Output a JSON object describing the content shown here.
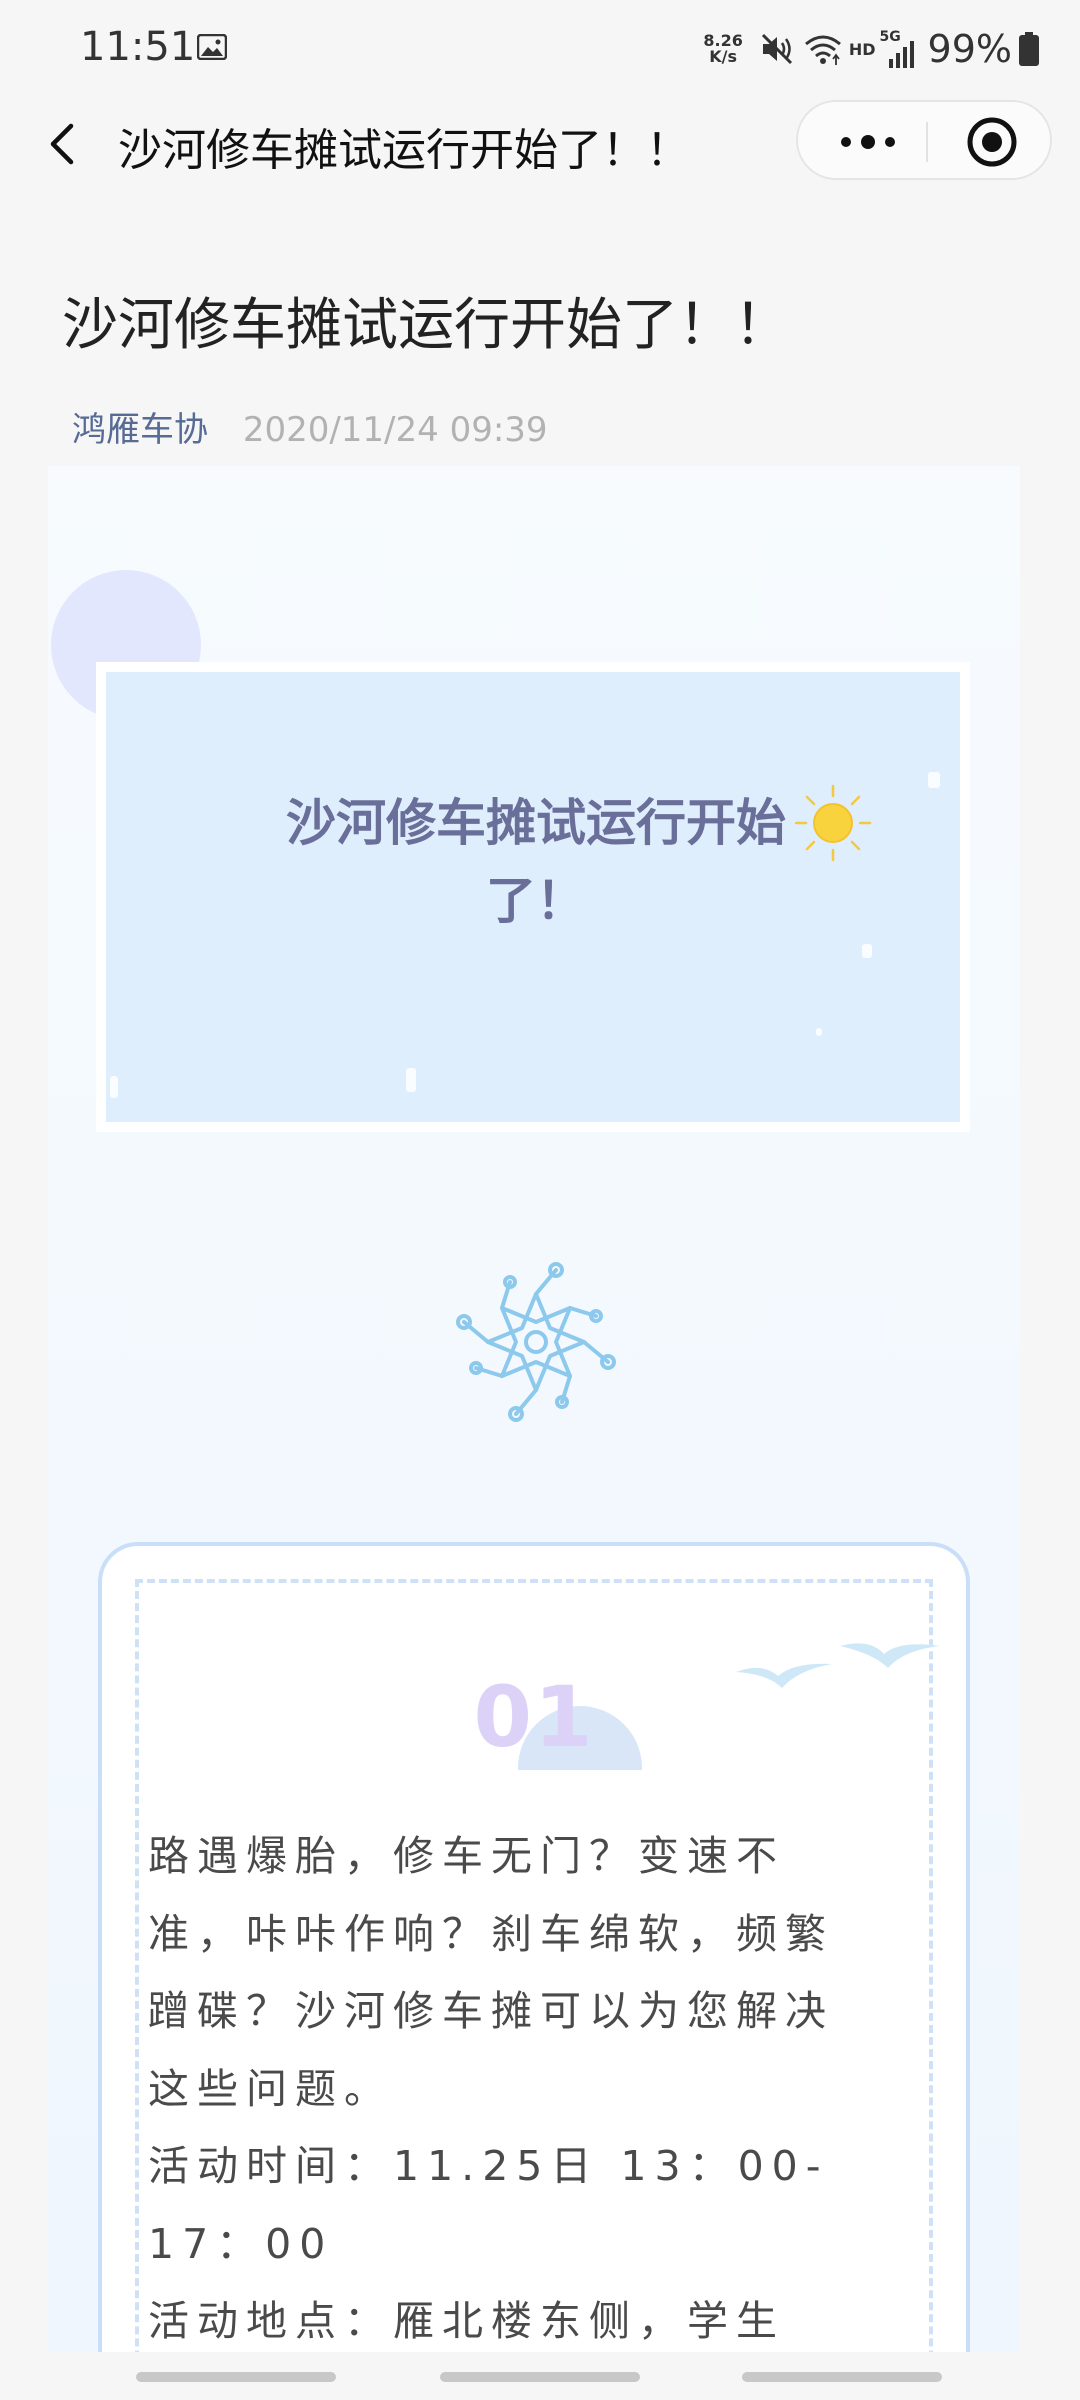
{
  "status_bar": {
    "time": "11:51",
    "net_speed_value": "8.26",
    "net_speed_unit": "K/s",
    "network_type": "HD",
    "signal_label": "5G",
    "battery": "99%",
    "icons": [
      "image-icon",
      "mute-icon",
      "wifi-icon",
      "signal-icon",
      "battery-icon"
    ]
  },
  "nav": {
    "title": "沙河修车摊试运行开始了！！",
    "icons": [
      "back-icon",
      "more-icon",
      "target-icon"
    ]
  },
  "article": {
    "title": "沙河修车摊试运行开始了！！",
    "author": "鸿雁车协",
    "date": "2020/11/24 09:39"
  },
  "content": {
    "banner_title": "沙河修车摊试运行开始了！",
    "section_number": "01",
    "paragraphs": [
      "路遇爆胎，修车无门？变速不准，咔咔作响？刹车绵软，频繁蹭碟？沙河修车摊可以为您解决这些问题。",
      "活动时间：11.25日 13：00-17：00",
      "活动地点：雁北楼东侧，学生"
    ],
    "decor_icons": [
      "sun-icon",
      "snowflake-icon",
      "birds-icon"
    ]
  },
  "colors": {
    "link": "#576b95",
    "banner_title": "#6a6f9a",
    "section_number": "#dcd1f6",
    "card_border": "#c9def8"
  }
}
